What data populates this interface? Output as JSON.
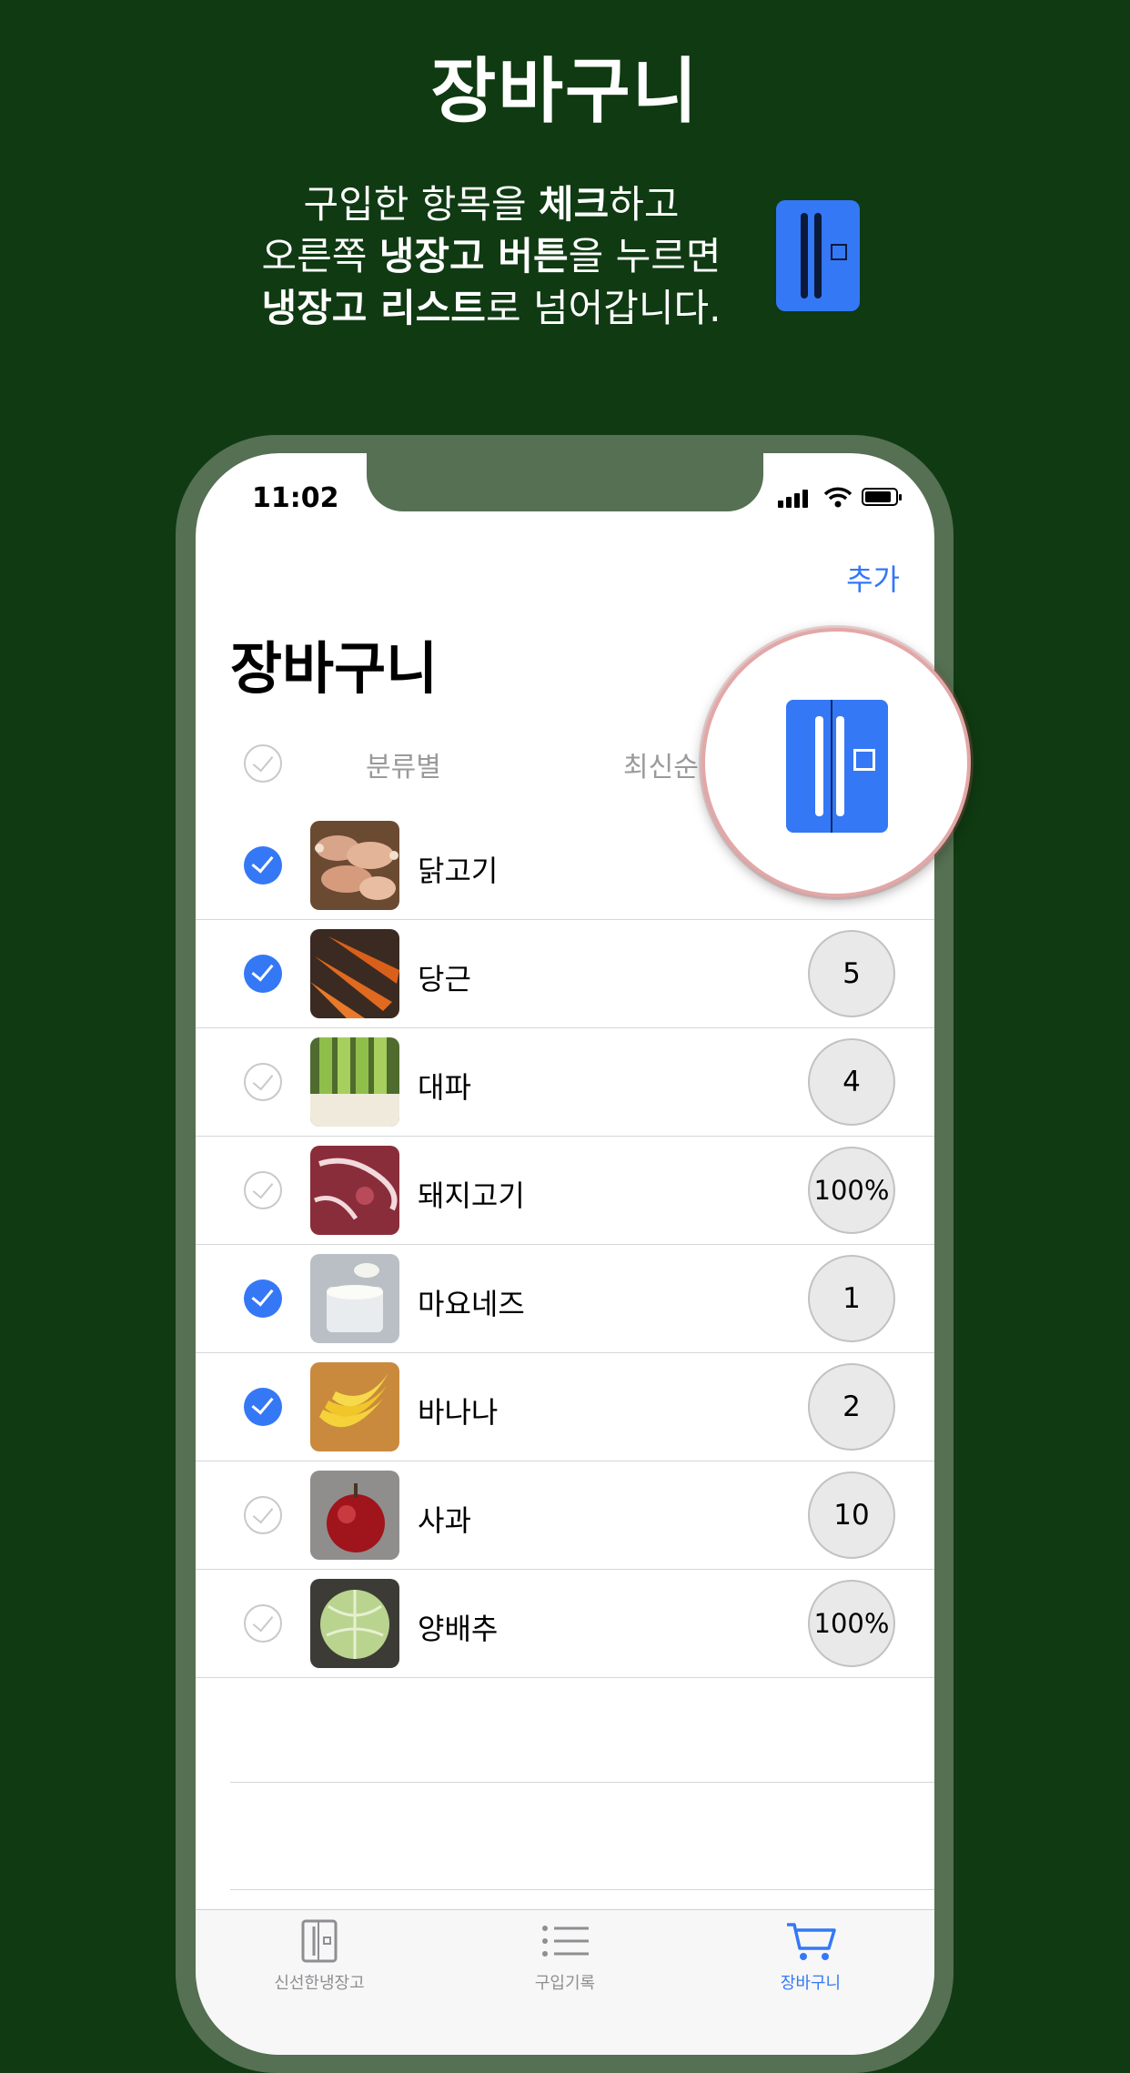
{
  "hero": {
    "title": "장바구니",
    "line1_a": "구입한 항목을 ",
    "line1_b": "체크",
    "line1_c": "하고",
    "line2_a": "오른쪽 ",
    "line2_b": "냉장고 버튼",
    "line2_c": "을 누르면",
    "line3_a": "냉장고 리스트",
    "line3_b": "로 넘어갑니다."
  },
  "status": {
    "time": "11:02"
  },
  "nav": {
    "add_label": "추가"
  },
  "page": {
    "title": "장바구니"
  },
  "filters": {
    "category_label": "분류별",
    "sort_label": "최신순"
  },
  "items": [
    {
      "name": "닭고기",
      "checked": true,
      "qty": "",
      "image": "chicken-drumsticks"
    },
    {
      "name": "당근",
      "checked": true,
      "qty": "5",
      "image": "carrots"
    },
    {
      "name": "대파",
      "checked": false,
      "qty": "4",
      "image": "green-onions"
    },
    {
      "name": "돼지고기",
      "checked": false,
      "qty": "100%",
      "image": "pork"
    },
    {
      "name": "마요네즈",
      "checked": true,
      "qty": "1",
      "image": "mayonnaise"
    },
    {
      "name": "바나나",
      "checked": true,
      "qty": "2",
      "image": "bananas"
    },
    {
      "name": "사과",
      "checked": false,
      "qty": "10",
      "image": "apple"
    },
    {
      "name": "양배추",
      "checked": false,
      "qty": "100%",
      "image": "cabbage"
    }
  ],
  "tabs": [
    {
      "label": "신선한냉장고",
      "icon": "fridge-icon",
      "active": false
    },
    {
      "label": "구입기록",
      "icon": "list-icon",
      "active": false
    },
    {
      "label": "장바구니",
      "icon": "cart-icon",
      "active": true
    }
  ],
  "colors": {
    "background": "#0f3a12",
    "accent": "#3478f6",
    "phone_frame": "#557052"
  }
}
